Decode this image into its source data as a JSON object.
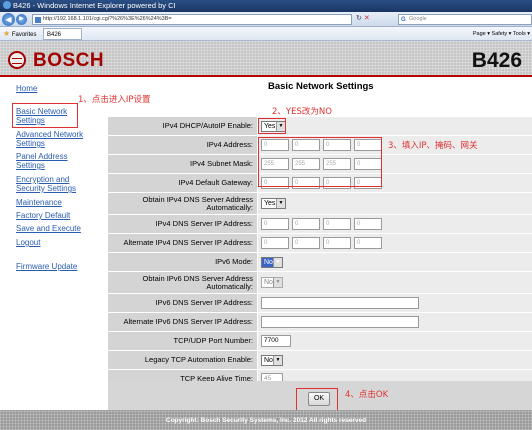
{
  "window": {
    "title": "B426 - Windows Internet Explorer powered by CI",
    "url": "http://192.168.1.101/cgi.cgi?%26%3E%26%24%3B=",
    "search_placeholder": "Google",
    "favorites_label": "Favorites",
    "tab_label": "B426",
    "toolbar_tools": "Page ▾  Safety ▾  Tools ▾"
  },
  "header": {
    "brand": "BOSCH",
    "model": "B426"
  },
  "nav": {
    "items": [
      {
        "label": "Home"
      },
      {
        "label": "Basic Network Settings"
      },
      {
        "label": "Advanced Network Settings"
      },
      {
        "label": "Panel Address Settings"
      },
      {
        "label": "Encryption and Security Settings"
      },
      {
        "label": "Maintenance"
      },
      {
        "label": "Factory Default"
      },
      {
        "label": "Save and Execute"
      },
      {
        "label": "Logout"
      },
      {
        "label": "Firmware Update"
      }
    ]
  },
  "annotations": {
    "a1": "1、点击进入IP设置",
    "a2": "2、YES改为NO",
    "a3": "3、填入IP、掩码、网关",
    "a4": "4、点击OK"
  },
  "page": {
    "title": "Basic Network Settings"
  },
  "form": {
    "dhcp": {
      "label": "IPv4 DHCP/AutoIP Enable:",
      "value": "Yes"
    },
    "ipv4_address": {
      "label": "IPv4 Address:",
      "octets": [
        "0",
        "0",
        "0",
        "0"
      ]
    },
    "subnet_mask": {
      "label": "IPv4 Subnet Mask:",
      "octets": [
        "255",
        "255",
        "255",
        "0"
      ]
    },
    "gateway": {
      "label": "IPv4 Default Gateway:",
      "octets": [
        "0",
        "0",
        "0",
        "0"
      ]
    },
    "obtain_dns4": {
      "label": "Obtain IPv4 DNS Server Address Automatically:",
      "value": "Yes"
    },
    "dns4": {
      "label": "IPv4 DNS Server IP Address:",
      "octets": [
        "0",
        "0",
        "0",
        "0"
      ]
    },
    "alt_dns4": {
      "label": "Alternate IPv4 DNS Server IP Address:",
      "octets": [
        "0",
        "0",
        "0",
        "0"
      ]
    },
    "ipv6_mode": {
      "label": "IPv6 Mode:",
      "value": "No"
    },
    "obtain_dns6": {
      "label": "Obtain IPv6 DNS Server Address Automatically:",
      "value": "No"
    },
    "dns6": {
      "label": "IPv6 DNS Server IP Address:",
      "value": ""
    },
    "alt_dns6": {
      "label": "Alternate IPv6 DNS Server IP Address:",
      "value": ""
    },
    "tcp_port": {
      "label": "TCP/UDP Port Number:",
      "value": "7700"
    },
    "legacy_tcp": {
      "label": "Legacy TCP Automation Enable:",
      "value": "No"
    },
    "keepalive": {
      "label": "TCP Keep Alive Time:",
      "value": "45"
    }
  },
  "ok_label": "OK",
  "footer": "Copyright: Bosch Security Systems, Inc. 2012   All rights reserved"
}
